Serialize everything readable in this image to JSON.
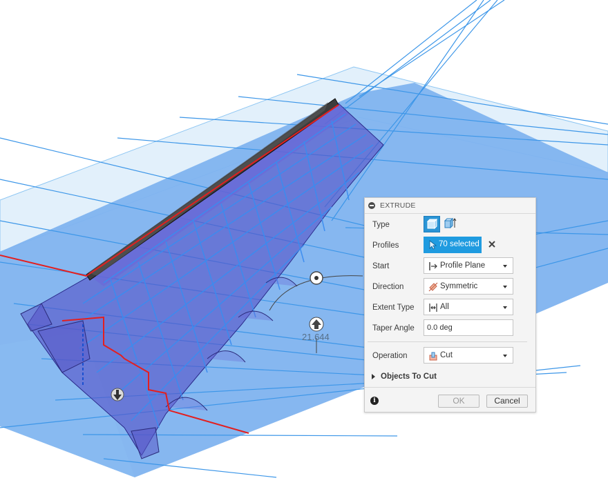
{
  "viewport": {
    "dimension_value": "21.644",
    "colors": {
      "plane_fill": "#7fb2ef",
      "plane_fill_light": "#dfeefa",
      "grid_line": "#3c96e8",
      "body_fill": "#5a56c8",
      "profile_edge": "#e31f1f",
      "spar_dark": "#3b3b3b"
    }
  },
  "dialog": {
    "title": "EXTRUDE",
    "collapse_icon": "minus-circle-icon",
    "rows": {
      "type": {
        "label": "Type",
        "options": [
          "solid-extrude-icon",
          "thin-extrude-icon"
        ],
        "selected": 0
      },
      "profiles": {
        "label": "Profiles",
        "value": "70 selected",
        "icon": "cursor-arrow-icon",
        "clear_icon": "close-icon"
      },
      "start": {
        "label": "Start",
        "value": "Profile Plane",
        "icon": "profile-plane-icon"
      },
      "direction": {
        "label": "Direction",
        "value": "Symmetric",
        "icon": "symmetric-icon"
      },
      "extent_type": {
        "label": "Extent Type",
        "value": "All",
        "icon": "extent-all-icon"
      },
      "taper_angle": {
        "label": "Taper Angle",
        "value": "0.0 deg"
      },
      "operation": {
        "label": "Operation",
        "value": "Cut",
        "icon": "cut-icon"
      }
    },
    "objects_to_cut": {
      "label": "Objects To Cut"
    },
    "footer": {
      "info_icon": "info-icon",
      "info_glyph": "i",
      "ok_label": "OK",
      "cancel_label": "Cancel"
    }
  }
}
